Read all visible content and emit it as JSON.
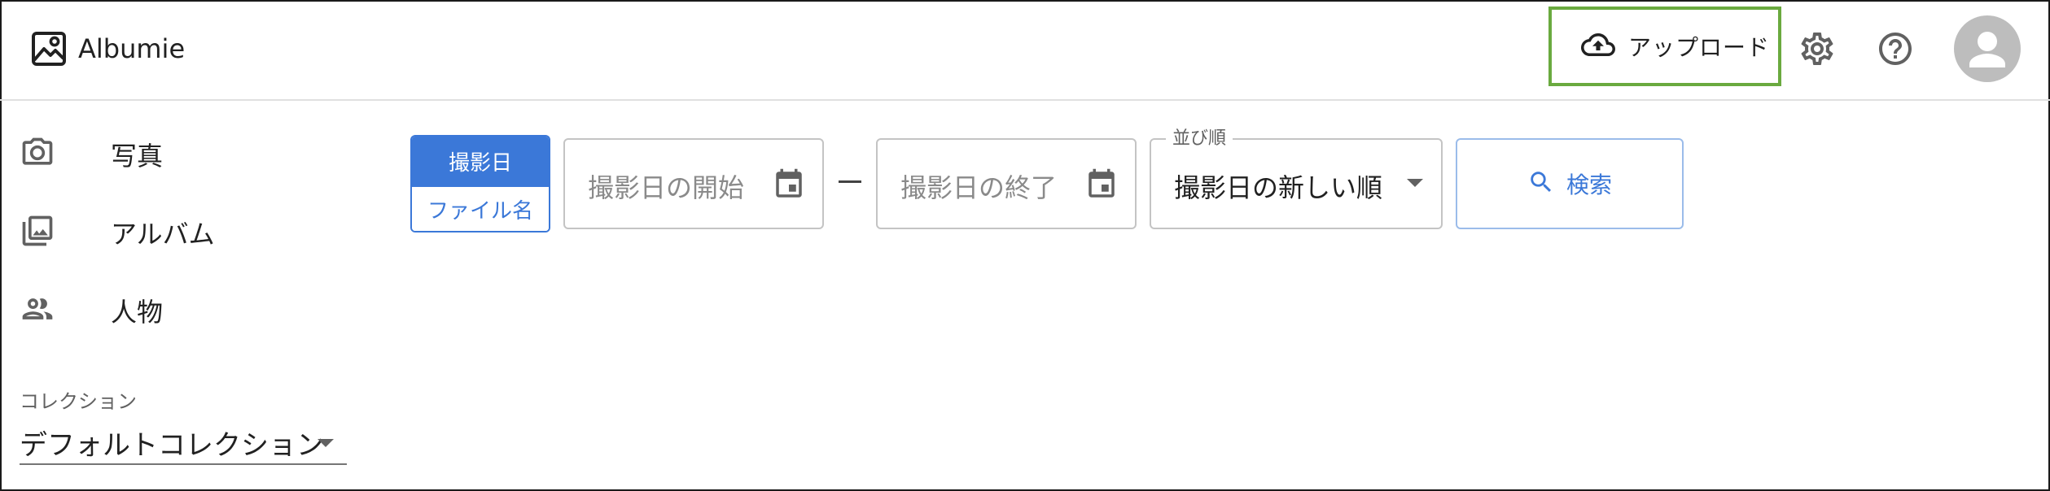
{
  "app": {
    "name": "Albumie"
  },
  "header": {
    "upload_label": "アップロード",
    "icons": [
      "cloud-upload-icon",
      "gear-icon",
      "help-icon",
      "account-icon"
    ]
  },
  "sidebar": {
    "items": [
      {
        "label": "写真",
        "icon": "camera-icon"
      },
      {
        "label": "アルバム",
        "icon": "photo-library-icon"
      },
      {
        "label": "人物",
        "icon": "people-icon"
      }
    ],
    "collection_caption": "コレクション",
    "collection_value": "デフォルトコレクション"
  },
  "toolbar": {
    "toggle": {
      "selected": "撮影日",
      "other": "ファイル名"
    },
    "start_placeholder": "撮影日の開始",
    "end_placeholder": "撮影日の終了",
    "sort_legend": "並び順",
    "sort_value": "撮影日の新しい順",
    "search_label": "検索"
  },
  "colors": {
    "accent": "#3b78d8",
    "highlight": "#6aaa3f",
    "avatar_bg": "#bdbdbd"
  }
}
